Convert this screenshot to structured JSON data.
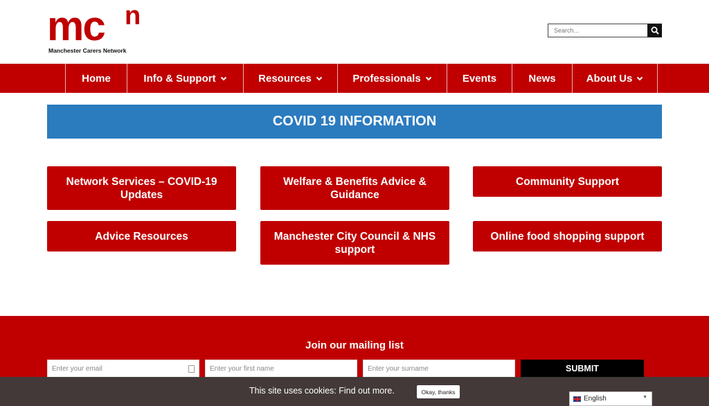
{
  "logo": {
    "mark": "mc",
    "superscript": "n",
    "tagline": "Manchester Carers Network"
  },
  "search": {
    "placeholder": "Search...",
    "icon": "search-icon"
  },
  "nav": {
    "items": [
      {
        "label": "Home",
        "dropdown": false
      },
      {
        "label": "Info & Support",
        "dropdown": true
      },
      {
        "label": "Resources",
        "dropdown": true
      },
      {
        "label": "Professionals",
        "dropdown": true
      },
      {
        "label": "Events",
        "dropdown": false
      },
      {
        "label": "News",
        "dropdown": false
      },
      {
        "label": "About Us",
        "dropdown": true
      }
    ]
  },
  "banner": {
    "title": "COVID 19 INFORMATION"
  },
  "tiles": [
    {
      "label": "Network Services – COVID-19 Updates"
    },
    {
      "label": "Welfare & Benefits Advice & Guidance"
    },
    {
      "label": "Community Support"
    },
    {
      "label": "Advice Resources"
    },
    {
      "label": "Manchester City Council & NHS support"
    },
    {
      "label": "Online food shopping support"
    }
  ],
  "mailing": {
    "title": "Join our mailing list",
    "email_placeholder": "Enter your email",
    "first_name_placeholder": "Enter your first name",
    "surname_placeholder": "Enter your surname",
    "submit_label": "SUBMIT"
  },
  "cookie": {
    "text": "This site uses cookies:",
    "link": "Find out more.",
    "button": "Okay, thanks"
  },
  "language": {
    "selected": "English"
  },
  "colors": {
    "brand_red": "#c00000",
    "banner_blue": "#2b7bbf",
    "dark": "#000000"
  }
}
